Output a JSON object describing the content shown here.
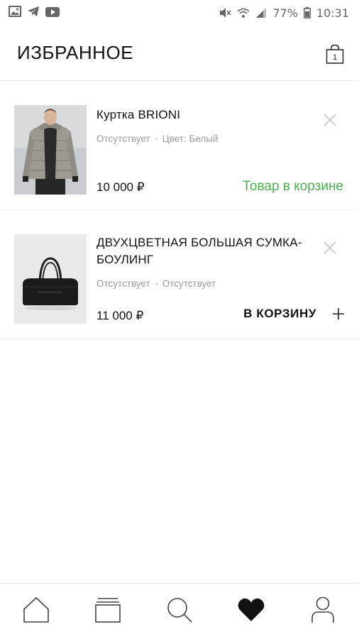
{
  "status_bar": {
    "battery": "77%",
    "time": "10:31",
    "icons_left": [
      "image-icon",
      "telegram-icon",
      "youtube-icon"
    ],
    "icons_right": [
      "mute-icon",
      "wifi-icon",
      "signal-icon",
      "battery-icon"
    ]
  },
  "header": {
    "title": "ИЗБРАННОЕ",
    "cart_count": "1"
  },
  "items": [
    {
      "name": "Куртка BRIONI",
      "availability": "Отсутствует",
      "attribute": "Цвет: Белый",
      "price": "10 000 ₽",
      "status_label": "Товар в корзине",
      "image": "puffer-jacket-photo"
    },
    {
      "name": "ДВУХЦВЕТНАЯ БОЛЬШАЯ СУМКА-БОУЛИНГ",
      "availability": "Отсутствует",
      "attribute": "Отсутствует",
      "price": "11 000 ₽",
      "action_label": "В КОРЗИНУ",
      "image": "bowling-bag-photo"
    }
  ],
  "bottom_nav": [
    "home-icon",
    "catalog-icon",
    "search-icon",
    "favorites-icon",
    "profile-icon"
  ],
  "colors": {
    "in_cart_green": "#4caf50",
    "divider": "#ececec",
    "meta_gray": "#9a9a9a"
  }
}
